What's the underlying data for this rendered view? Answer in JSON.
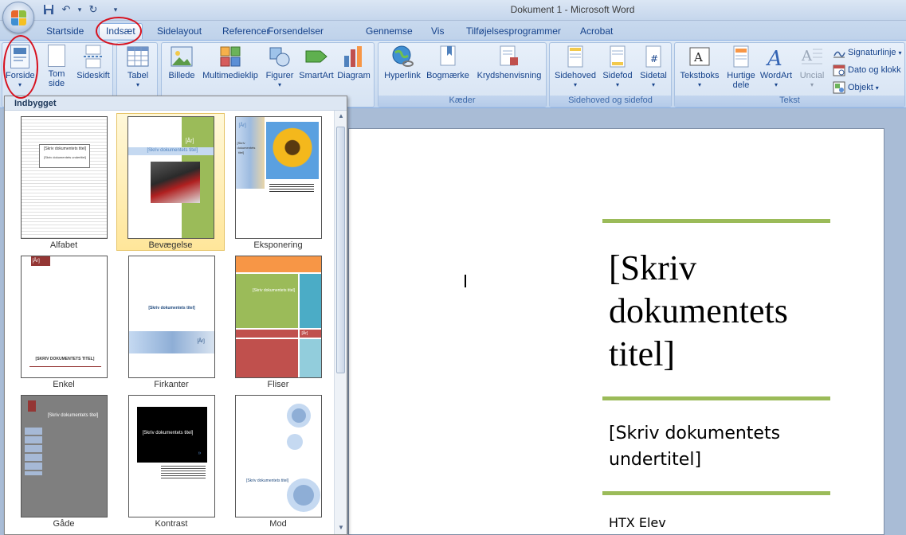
{
  "window": {
    "title": "Dokument 1 - Microsoft Word"
  },
  "tabs": [
    "Startside",
    "Indsæt",
    "Sidelayout",
    "Referencer",
    "Forsendelser",
    "Gennemse",
    "Vis",
    "Tilføjelsesprogrammer",
    "Acrobat"
  ],
  "active_tab": "Indsæt",
  "ribbon": {
    "sider": {
      "forside": "Forside",
      "tom_side_1": "Tom",
      "tom_side_2": "side",
      "sideskift": "Sideskift"
    },
    "tabeller": {
      "tabel": "Tabel"
    },
    "illustrationer": {
      "billede": "Billede",
      "medieklip": "Multimedieklip",
      "figurer": "Figurer",
      "smartart": "SmartArt",
      "diagram": "Diagram"
    },
    "kaeder": {
      "label": "Kæder",
      "hyperlink": "Hyperlink",
      "bogmaerke": "Bogmærke",
      "krydshenvisning": "Krydshenvisning"
    },
    "sidehoved": {
      "label": "Sidehoved og sidefod",
      "sidehoved": "Sidehoved",
      "sidefod": "Sidefod",
      "sidetal": "Sidetal"
    },
    "tekst": {
      "label": "Tekst",
      "tekstboks": "Tekstboks",
      "hurtige_1": "Hurtige",
      "hurtige_2": "dele",
      "wordart": "WordArt",
      "uncial": "Uncial",
      "signatur": "Signaturlinje",
      "dato": "Dato og klokk",
      "objekt": "Objekt"
    }
  },
  "gallery": {
    "header": "Indbygget",
    "tiles": [
      "Alfabet",
      "Bevægelse",
      "Eksponering",
      "Enkel",
      "Firkanter",
      "Fliser",
      "Gåde",
      "Kontrast",
      "Mod"
    ],
    "thumb_texts": {
      "alfabet_title": "[Skriv dokumentets titel]",
      "alfabet_sub": "[Skriv dokumentets undertitel]",
      "bevaegelse_year": "[År]",
      "bevaegelse_title": "[Skriv dokumentets titel]",
      "eksponering_year": "[År]",
      "eksponering_title": "[Skriv dokumentets titel]",
      "enkel_year": "[År]",
      "enkel_title": "[SKRIV DOKUMENTETS TITEL]",
      "firkanter_title": "[Skriv dokumentets titel]",
      "firkanter_year": "[År]",
      "fliser_title": "[Skriv dokumentets titel]",
      "fliser_year": "[År]",
      "gaade_title": "[Skriv dokumentets titel]",
      "kontrast_title": "[Skriv dokumentets titel]",
      "mod_title": "[Skriv dokumentets titel]"
    }
  },
  "document": {
    "title": "[Skriv dokumentets titel]",
    "subtitle": "[Skriv dokumentets undertitel]",
    "author": "HTX Elev"
  },
  "colors": {
    "accent_green": "#9bbb59",
    "highlight_red": "#d7121f",
    "ribbon_text": "#15428b"
  }
}
